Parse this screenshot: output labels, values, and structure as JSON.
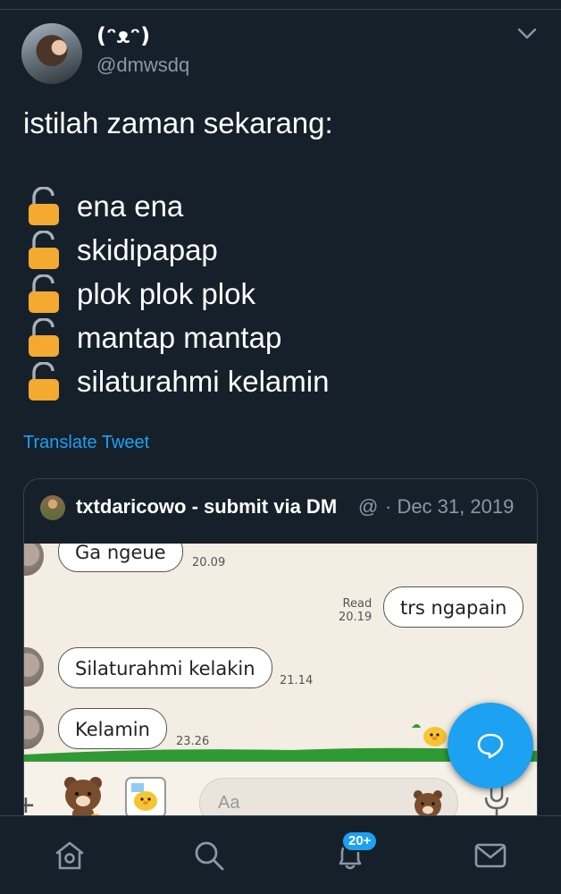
{
  "tweet": {
    "display_name": "(ᵔᴥᵔ)",
    "handle": "@dmwsdq",
    "text": "istilah zaman sekarang:",
    "list_items": [
      "ena ena",
      "skidipapap",
      "plok plok plok",
      "mantap mantap",
      "silaturahmi kelamin"
    ],
    "list_icon": "unlocked-padlock-icon",
    "translate_label": "Translate Tweet"
  },
  "quote": {
    "name": "txtdaricowo - submit via DM",
    "handle": "@",
    "date": "· Dec 31, 2019",
    "chat": {
      "messages": [
        {
          "text": "Ga ngeue",
          "time": "20.09",
          "side": "left"
        },
        {
          "text": "trs ngapain",
          "read": "Read",
          "time": "20.19",
          "side": "right"
        },
        {
          "text": "Silaturahmi kelakin",
          "time": "21.14",
          "side": "left"
        },
        {
          "text": "Kelamin",
          "time": "23.26",
          "side": "left"
        }
      ],
      "input_placeholder": "Aa"
    }
  },
  "nav": {
    "items": [
      "home-icon",
      "search-icon",
      "notifications-icon",
      "messages-icon"
    ],
    "notification_badge": "20+"
  },
  "colors": {
    "background": "#15202b",
    "accent": "#1da1f2",
    "secondary_text": "#8899a6",
    "lock": "#f4a930"
  }
}
